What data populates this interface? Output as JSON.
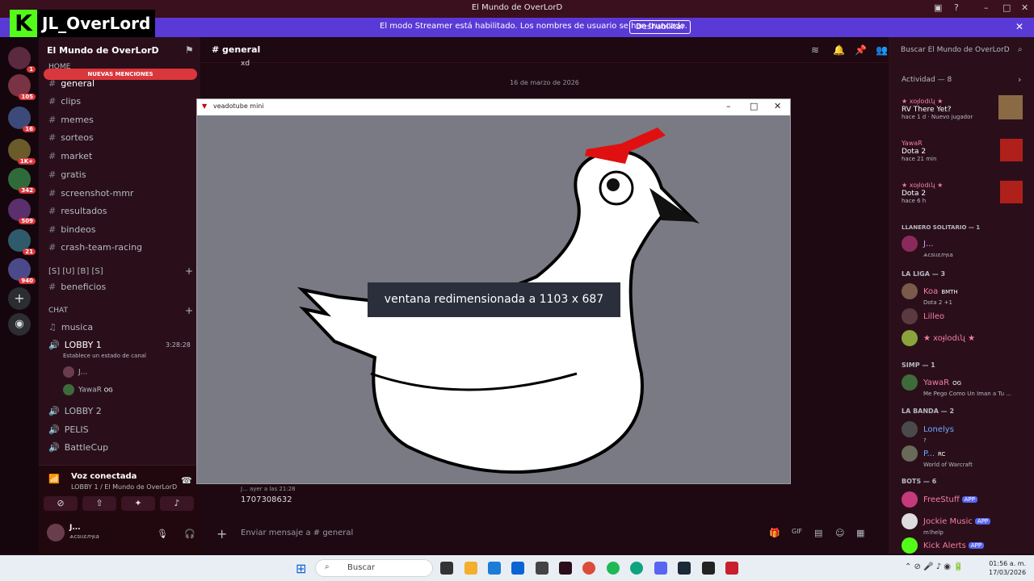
{
  "window": {
    "title": "El Mundo de OverLorD",
    "streamer_banner": "El modo Streamer está habilitado. Los nombres de usuario se han truncado.",
    "disable_button": "Deshabilitar"
  },
  "brand": {
    "letter": "K",
    "name": "JL_OverLord"
  },
  "rail": {
    "badges": [
      "1",
      "105",
      "16",
      "1K+",
      "342",
      "509",
      "21",
      "940"
    ]
  },
  "sidebar": {
    "server_name": "El Mundo de OverLorD",
    "home_category": "HOME",
    "new_mentions": "NUEVAS MENCIONES",
    "channels": [
      "general",
      "clips",
      "memes",
      "sorteos",
      "market",
      "gratis",
      "screenshot-mmr",
      "resultados",
      "bindeos",
      "crash-team-racing"
    ],
    "sub_category": "[S] [U] [B] [S]",
    "sub_channel": "beneficios",
    "chat_category": "CHAT",
    "music_channel": "musica",
    "lobby1": "LOBBY 1",
    "lobby1_time": "3:28:28",
    "lobby1_status": "Establece un estado de canal",
    "lobby1_users": [
      "J...",
      "YawaR"
    ],
    "lobby1_user_tag": "OG",
    "lobby2": "LOBBY 2",
    "pelis": "PELIS",
    "battlecup": "BattleCup",
    "voice_title": "Voz conectada",
    "voice_sub": "LOBBY 1 / El Mundo de OverLorD",
    "me_name": "J...",
    "me_status": "ѧcsɩɩɛлӌɩa"
  },
  "chat": {
    "channel": "general",
    "date": "16 de marzo de 2026",
    "top_msg": "xd",
    "last_author": "J...",
    "last_time": "ayer a las 21:28",
    "last_msg": "1707308632",
    "composer_placeholder": "Enviar mensaje a # general"
  },
  "overlay": {
    "title": "veadotube mini",
    "toast": "ventana redimensionada a 1103 x 687"
  },
  "members": {
    "search_placeholder": "Buscar El Mundo de OverLorD",
    "activity_header": "Actividad — 8",
    "activities": [
      {
        "user": "★ xoɟlodɩʯ ★",
        "game": "RV There Yet?",
        "meta": "hace 1 d · Nuevo jugador"
      },
      {
        "user": "YawaR",
        "game": "Dota 2",
        "meta": "hace 21 min"
      },
      {
        "user": "★ xoɟlodɩʯ ★",
        "game": "Dota 2",
        "meta": "hace 6 h"
      }
    ],
    "sections": [
      {
        "title": "LLANERO SOLITARIO — 1",
        "members": [
          {
            "name": "J...",
            "status": "ѧcsɩɩɛлӌɩa",
            "tag": ""
          }
        ]
      },
      {
        "title": "LA LIGA — 3",
        "members": [
          {
            "name": "Koa",
            "status": "Dota 2 +1",
            "tag": "BMTH"
          },
          {
            "name": "Lilleo",
            "status": "",
            "tag": ""
          },
          {
            "name": "★ xoɟlodɩʯ ★",
            "status": "",
            "tag": ""
          }
        ]
      },
      {
        "title": "SIMP — 1",
        "members": [
          {
            "name": "YawaR",
            "status": "Me Pego Como Un Iman a Tu ...",
            "tag": "OG"
          }
        ]
      },
      {
        "title": "LA BANDA — 2",
        "members": [
          {
            "name": "Lonelys",
            "status": "?",
            "tag": ""
          },
          {
            "name": "P...",
            "status": "World of Warcraft",
            "tag": "RC"
          }
        ]
      },
      {
        "title": "BOTS — 6",
        "members": [
          {
            "name": "FreeStuff",
            "status": "",
            "tag": "APP"
          },
          {
            "name": "Jockie Music",
            "status": "m!help",
            "tag": "APP"
          },
          {
            "name": "Kick Alerts",
            "status": "",
            "tag": "APP"
          }
        ]
      }
    ]
  },
  "taskbar": {
    "search": "Buscar",
    "time": "01:56 a. m.",
    "date": "17/03/2026"
  },
  "colors": {
    "accent": "#5865f2",
    "danger": "#da373c",
    "kick": "#53fc18",
    "banner": "#5a3ad6"
  }
}
